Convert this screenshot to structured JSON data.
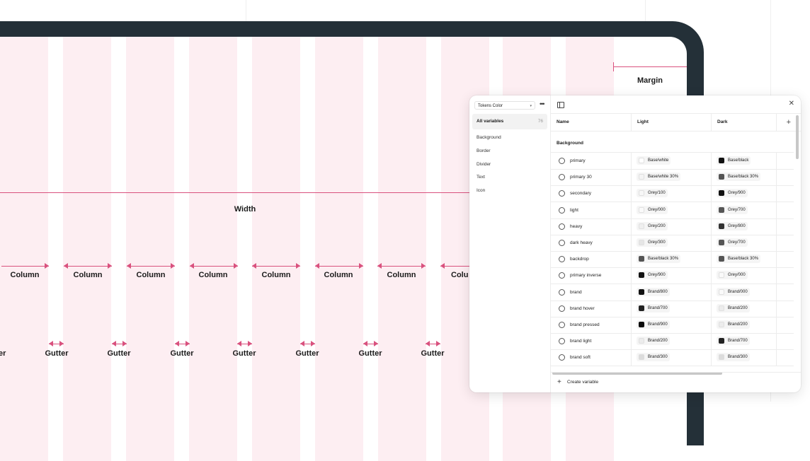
{
  "layout_labels": {
    "margin": "Margin",
    "width": "Width",
    "columns": [
      "Column",
      "Column",
      "Column",
      "Column",
      "Column",
      "Column",
      "Column",
      "Colu"
    ],
    "gutters": [
      "er",
      "Gutter",
      "Gutter",
      "Gutter",
      "Gutter",
      "Gutter",
      "Gutter",
      "Gutter"
    ]
  },
  "colors": {
    "accent": "#d9517e",
    "column_fill": "#fdeef2",
    "device_frame": "#243038"
  },
  "panel": {
    "collection_select": "Tokens Color",
    "all_variables": {
      "label": "All variables",
      "count": "76"
    },
    "groups": [
      "Background",
      "Border",
      "Divider",
      "Text",
      "Icon"
    ],
    "headers": {
      "name": "Name",
      "light": "Light",
      "dark": "Dark"
    },
    "section_title": "Background",
    "rows": [
      {
        "name": "primary",
        "light": "Base/white",
        "dark": "Base/black",
        "light_color": "#ffffff",
        "dark_color": "#111111"
      },
      {
        "name": "primary 30",
        "light": "Base/white 30%",
        "dark": "Base/black 30%",
        "light_color": "#f4f4f4",
        "dark_color": "#555555"
      },
      {
        "name": "secondary",
        "light": "Grey/100",
        "dark": "Grey/900",
        "light_color": "#f7f7f7",
        "dark_color": "#111111"
      },
      {
        "name": "light",
        "light": "Grey/000",
        "dark": "Grey/700",
        "light_color": "#fafafa",
        "dark_color": "#555555"
      },
      {
        "name": "heavy",
        "light": "Grey/200",
        "dark": "Grey/800",
        "light_color": "#efefef",
        "dark_color": "#333333"
      },
      {
        "name": "dark heavy",
        "light": "Grey/300",
        "dark": "Grey/700",
        "light_color": "#e6e6e6",
        "dark_color": "#555555"
      },
      {
        "name": "backdrop",
        "light": "Base/black 30%",
        "dark": "Base/black 30%",
        "light_color": "#555555",
        "dark_color": "#555555"
      },
      {
        "name": "primary inverse",
        "light": "Grey/900",
        "dark": "Grey/000",
        "light_color": "#111111",
        "dark_color": "#fafafa"
      },
      {
        "name": "brand",
        "light": "Brand/800",
        "dark": "Brand/000",
        "light_color": "#111111",
        "dark_color": "#fafafa"
      },
      {
        "name": "brand hover",
        "light": "Brand/700",
        "dark": "Brand/200",
        "light_color": "#222222",
        "dark_color": "#ececec"
      },
      {
        "name": "brand pressed",
        "light": "Brand/900",
        "dark": "Brand/200",
        "light_color": "#0a0a0a",
        "dark_color": "#ececec"
      },
      {
        "name": "brand light",
        "light": "Brand/200",
        "dark": "Brand/700",
        "light_color": "#ececec",
        "dark_color": "#222222"
      },
      {
        "name": "brand soft",
        "light": "Brand/300",
        "dark": "Brand/300",
        "light_color": "#dcdcdc",
        "dark_color": "#dcdcdc"
      }
    ],
    "create_variable": "Create variable"
  }
}
